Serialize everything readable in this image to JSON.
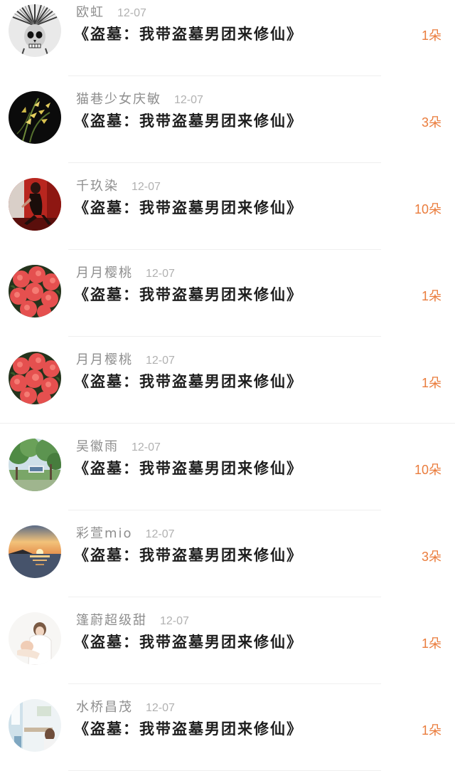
{
  "gift_records": [
    {
      "user": "欧虹",
      "date": "12-07",
      "book": "《盗墓：我带盗墓男团来修仙》",
      "count": "1朵",
      "avatar_icon": "skull-headdress-avatar"
    },
    {
      "user": "猫巷少女庆敏",
      "date": "12-07",
      "book": "《盗墓：我带盗墓男团来修仙》",
      "count": "3朵",
      "avatar_icon": "orchid-avatar"
    },
    {
      "user": "千玖染",
      "date": "12-07",
      "book": "《盗墓：我带盗墓男团来修仙》",
      "count": "10朵",
      "avatar_icon": "woman-red-room-avatar"
    },
    {
      "user": "月月樱桃",
      "date": "12-07",
      "book": "《盗墓：我带盗墓男团来修仙》",
      "count": "1朵",
      "avatar_icon": "red-flowers-avatar"
    },
    {
      "user": "月月樱桃",
      "date": "12-07",
      "book": "《盗墓：我带盗墓男团来修仙》",
      "count": "1朵",
      "avatar_icon": "red-flowers-avatar"
    },
    {
      "user": "吴徽雨",
      "date": "12-07",
      "book": "《盗墓：我带盗墓男团来修仙》",
      "count": "10朵",
      "avatar_icon": "park-trees-avatar"
    },
    {
      "user": "彩萱mio",
      "date": "12-07",
      "book": "《盗墓：我带盗墓男团来修仙》",
      "count": "3朵",
      "avatar_icon": "sunset-lake-avatar"
    },
    {
      "user": "篷蔚超级甜",
      "date": "12-07",
      "book": "《盗墓：我带盗墓男团来修仙》",
      "count": "1朵",
      "avatar_icon": "mother-baby-avatar"
    },
    {
      "user": "水桥昌茂",
      "date": "12-07",
      "book": "《盗墓：我带盗墓男团来修仙》",
      "count": "1朵",
      "avatar_icon": "room-interior-avatar"
    }
  ],
  "colors": {
    "count_orange": "#ea7c3c",
    "name_gray": "#8e8e8e",
    "date_gray": "#b1b1b1",
    "title_black": "#1e1e1e",
    "divider": "#efefef"
  }
}
